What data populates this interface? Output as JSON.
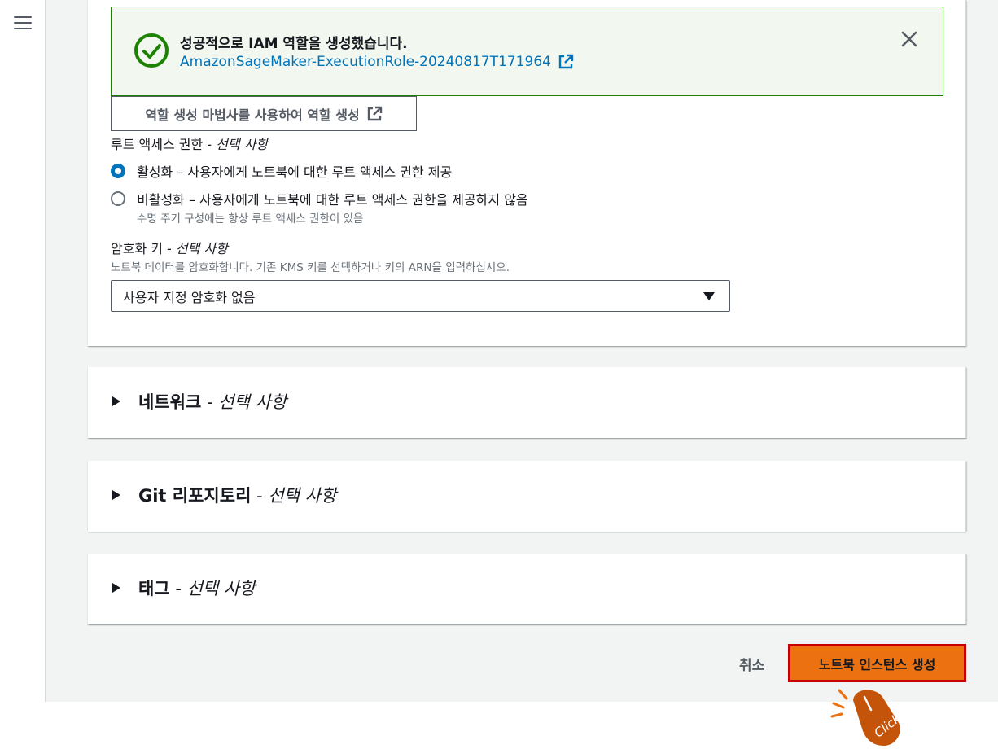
{
  "flash": {
    "title": "성공적으로 IAM 역할을 생성했습니다.",
    "link": "AmazonSageMaker-ExecutionRole-20240817T171964"
  },
  "wizard_button_label": "역할 생성 마법사를 사용하여 역할 생성",
  "root_access": {
    "label": "루트 액세스 권한",
    "optional": "선택 사항",
    "options": [
      {
        "label": "활성화 – 사용자에게 노트북에 대한 루트 액세스 권한 제공",
        "selected": true
      },
      {
        "label": "비활성화 – 사용자에게 노트북에 대한 루트 액세스 권한을 제공하지 않음",
        "selected": false
      }
    ],
    "disable_note": "수명 주기 구성에는 항상 루트 액세스 권한이 있음"
  },
  "encryption": {
    "label": "암호화 키",
    "optional": "선택 사항",
    "description": "노트북 데이터를 암호화합니다. 기존 KMS 키를 선택하거나 키의 ARN을 입력하십시오.",
    "selected": "사용자 지정 암호화 없음"
  },
  "sections": [
    {
      "title": "네트워크",
      "optional": "선택 사항"
    },
    {
      "title": "Git 리포지토리",
      "optional": "선택 사항"
    },
    {
      "title": "태그",
      "optional": "선택 사항"
    }
  ],
  "footer": {
    "cancel": "취소",
    "create": "노트북 인스턴스 생성"
  },
  "click_annotation": "Click",
  "colors": {
    "success": "#1d8102",
    "link": "#0073bb",
    "primary": "#ec7211",
    "highlight": "#c40000"
  }
}
